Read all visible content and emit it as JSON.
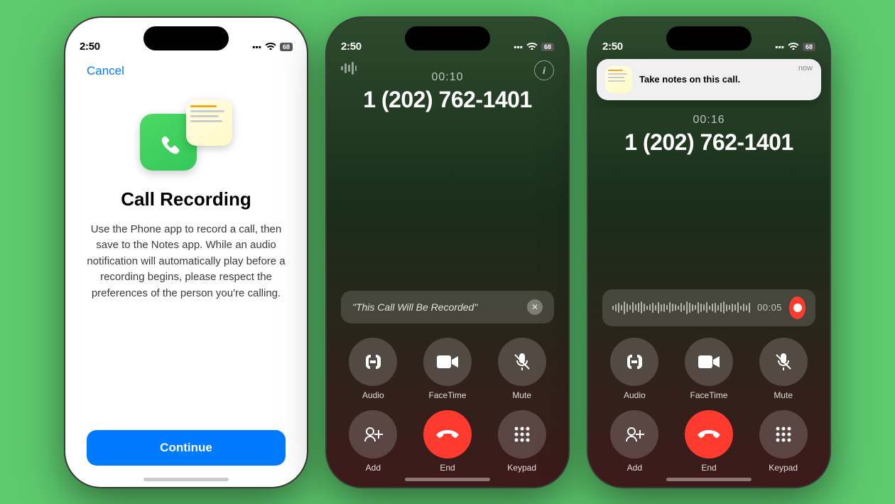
{
  "bg_color": "#5dca6e",
  "phone1": {
    "status_time": "2:50",
    "cancel_label": "Cancel",
    "title": "Call Recording",
    "description": "Use the Phone app to record a call, then save to the Notes app. While an audio notification will automatically play before a recording begins, please respect the preferences of the person you're calling.",
    "continue_label": "Continue"
  },
  "phone2": {
    "status_time": "2:50",
    "timer": "00:10",
    "number": "1 (202) 762-1401",
    "recording_notice": "\"This Call Will Be Recorded\"",
    "buttons": [
      {
        "label": "Audio",
        "icon": "speaker"
      },
      {
        "label": "FaceTime",
        "icon": "facetime"
      },
      {
        "label": "Mute",
        "icon": "mute"
      },
      {
        "label": "Add",
        "icon": "add"
      },
      {
        "label": "End",
        "icon": "end"
      },
      {
        "label": "Keypad",
        "icon": "keypad"
      }
    ]
  },
  "phone3": {
    "status_time": "2:50",
    "timer": "00:16",
    "number": "1 (202) 762-1401",
    "wave_time": "00:05",
    "notification": {
      "title": "Take notes on this call.",
      "time": "now"
    },
    "buttons": [
      {
        "label": "Audio",
        "icon": "speaker"
      },
      {
        "label": "FaceTime",
        "icon": "facetime"
      },
      {
        "label": "Mute",
        "icon": "mute"
      },
      {
        "label": "Add",
        "icon": "add"
      },
      {
        "label": "End",
        "icon": "end"
      },
      {
        "label": "Keypad",
        "icon": "keypad"
      }
    ]
  }
}
